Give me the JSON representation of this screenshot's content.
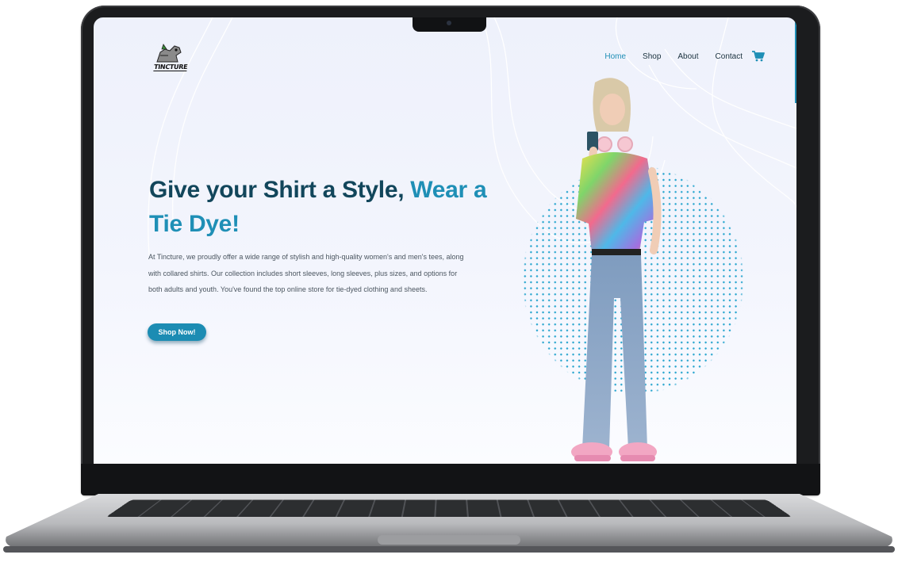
{
  "brand": {
    "logo_text": "TINCTURE"
  },
  "nav": {
    "items": [
      {
        "label": "Home",
        "active": true
      },
      {
        "label": "Shop",
        "active": false
      },
      {
        "label": "About",
        "active": false
      },
      {
        "label": "Contact",
        "active": false
      }
    ],
    "cart_icon": "cart-icon"
  },
  "hero": {
    "title_part1": "Give your Shirt a Style,",
    "title_part2": "Wear a Tie Dye!",
    "description": "At Tincture, we proudly offer a wide range of stylish and high-quality women's and men's tees, along with collared shirts. Our collection includes short sleeves, long sleeves, plus sizes, and options for both adults and youth. You've found the top online store for tie-dyed clothing and sheets.",
    "cta_label": "Shop Now!"
  },
  "colors": {
    "primary": "#1f8fb6",
    "heading": "#12465b",
    "background": "#eef1fb"
  }
}
